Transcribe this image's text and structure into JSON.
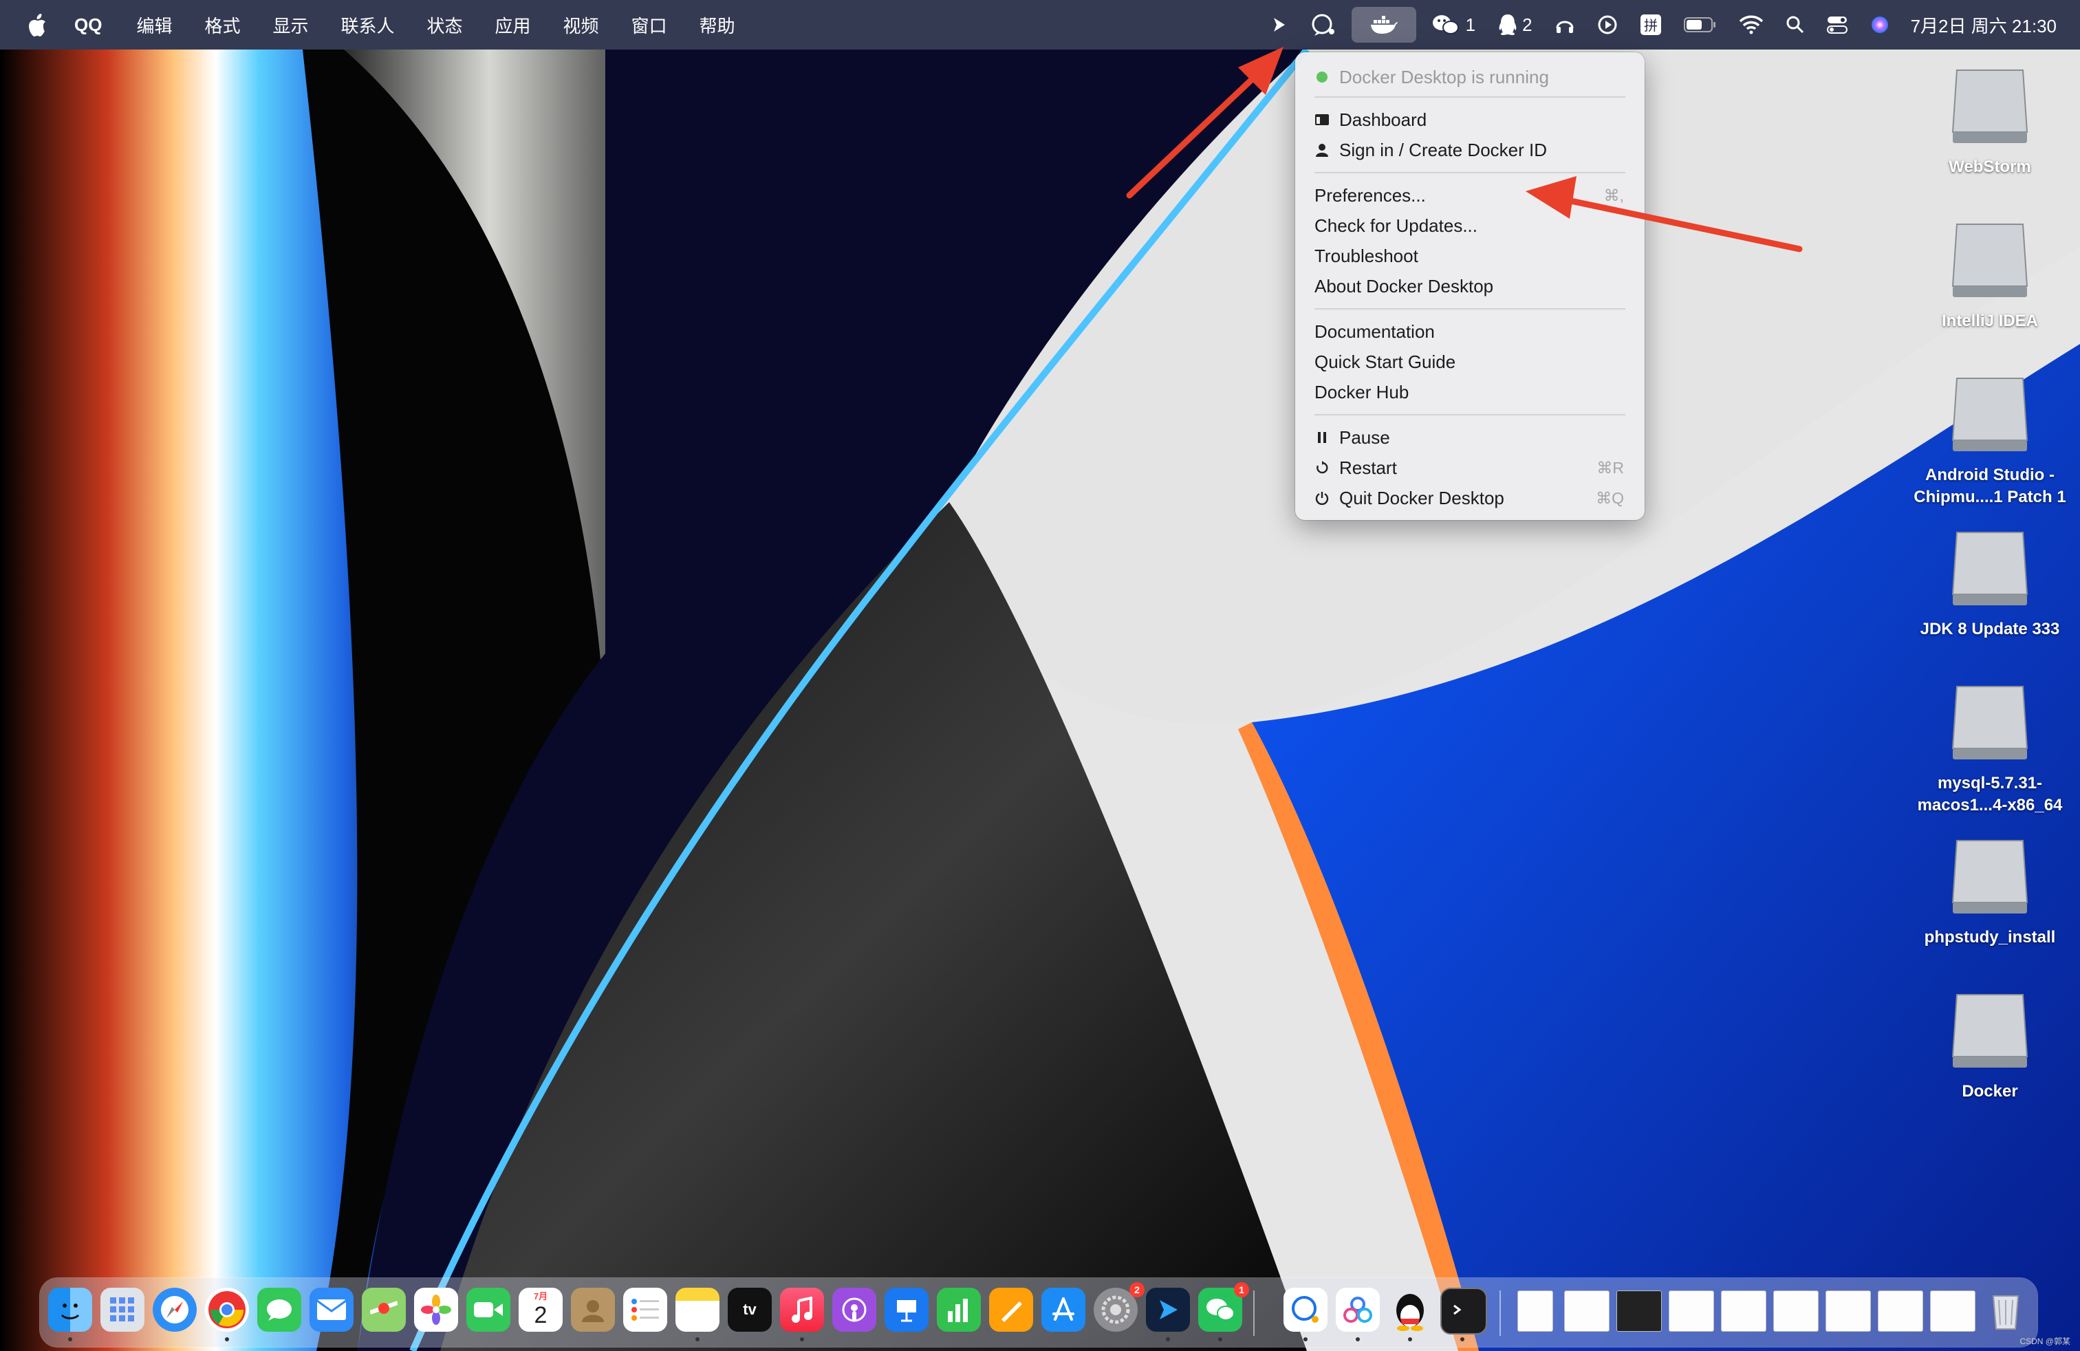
{
  "menubar": {
    "app_name": "QQ",
    "menus": [
      "编辑",
      "格式",
      "显示",
      "联系人",
      "状态",
      "应用",
      "视频",
      "窗口",
      "帮助"
    ],
    "wechat_count": "1",
    "qq_count": "2",
    "clock": "7月2日 周六 21:30"
  },
  "docker_menu": {
    "status": "Docker Desktop is running",
    "dashboard": "Dashboard",
    "sign_in": "Sign in / Create Docker ID",
    "preferences": "Preferences...",
    "preferences_shortcut": "⌘,",
    "check_updates": "Check for Updates...",
    "troubleshoot": "Troubleshoot",
    "about": "About Docker Desktop",
    "documentation": "Documentation",
    "quick_start": "Quick Start Guide",
    "docker_hub": "Docker Hub",
    "pause": "Pause",
    "restart": "Restart",
    "restart_shortcut": "⌘R",
    "quit": "Quit Docker Desktop",
    "quit_shortcut": "⌘Q"
  },
  "desktop_icons": [
    {
      "label": "WebStorm"
    },
    {
      "label": "IntelliJ IDEA"
    },
    {
      "label": "Android Studio - Chipmu....1 Patch 1"
    },
    {
      "label": "JDK 8 Update 333"
    },
    {
      "label": "mysql-5.7.31-macos1...4-x86_64"
    },
    {
      "label": "phpstudy_install"
    },
    {
      "label": "Docker"
    }
  ],
  "dock": {
    "calendar_month": "7月",
    "calendar_day": "2",
    "appletv_label": "tv",
    "settings_badge": "2",
    "wechat_badge": "1"
  },
  "watermark": "CSDN @郭某",
  "colors": {
    "menubar_bg": "#262c46",
    "menu_bg": "#ececee",
    "arrow": "#e8402a",
    "status_green": "#5fc35f"
  }
}
